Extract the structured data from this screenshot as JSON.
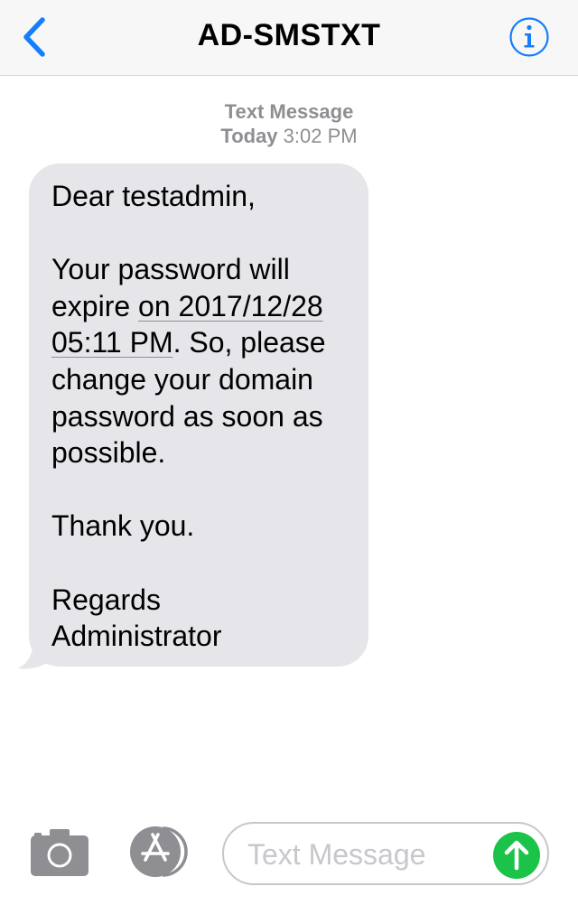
{
  "header": {
    "title": "AD-SMSTXT",
    "back_icon": "chevron-left-icon",
    "info_icon": "info-icon",
    "accent_color": "#147efb"
  },
  "thread": {
    "service_label": "Text Message",
    "day": "Today",
    "time": "3:02 PM"
  },
  "message": {
    "greeting": "Dear testadmin,",
    "body_line1": "Your password will",
    "body_line2_pre": "expire ",
    "body_line2_link": "on 2017/12/28",
    "body_line3_link": "05:11 PM",
    "body_line3_post": ". So, please",
    "body_line4": "change your domain",
    "body_line5": "password as soon as",
    "body_line6": "possible.",
    "thanks": "Thank you.",
    "closing": "Regards",
    "signature": "Administrator",
    "bubble_color": "#e5e5ea"
  },
  "composer": {
    "camera_icon": "camera-icon",
    "apps_icon": "app-store-icon",
    "placeholder": "Text Message",
    "send_icon": "send-arrow-icon",
    "send_color": "#1bc449"
  }
}
